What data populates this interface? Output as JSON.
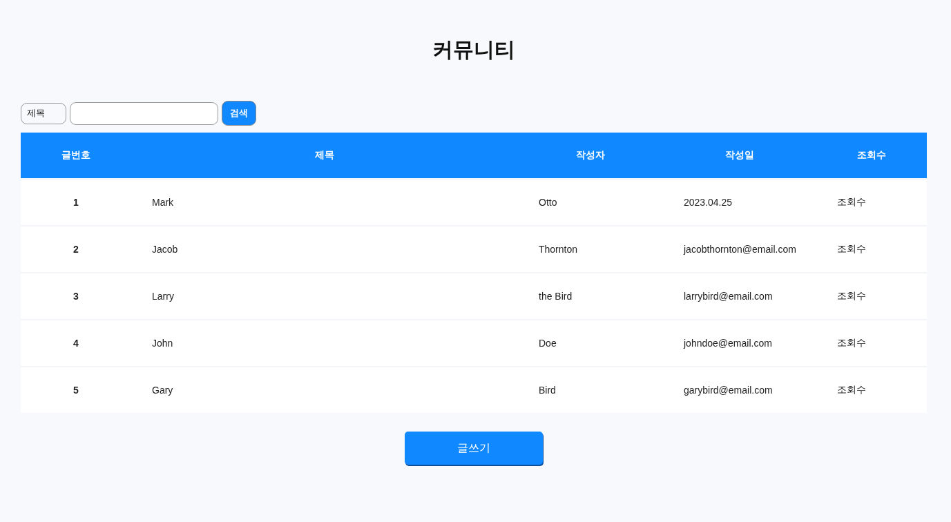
{
  "title": "커뮤니티",
  "search": {
    "field_select": "제목",
    "button": "검색"
  },
  "table": {
    "columns": [
      "글번호",
      "제목",
      "작성자",
      "작성일",
      "조회수"
    ],
    "rows": [
      [
        "1",
        "Mark",
        "Otto",
        "2023.04.25",
        "조회수"
      ],
      [
        "2",
        "Jacob",
        "Thornton",
        "jacobthornton@email.com",
        "조회수"
      ],
      [
        "3",
        "Larry",
        "the Bird",
        "larrybird@email.com",
        "조회수"
      ],
      [
        "4",
        "John",
        "Doe",
        "johndoe@email.com",
        "조회수"
      ],
      [
        "5",
        "Gary",
        "Bird",
        "garybird@email.com",
        "조회수"
      ]
    ]
  },
  "write_button": "글쓰기"
}
